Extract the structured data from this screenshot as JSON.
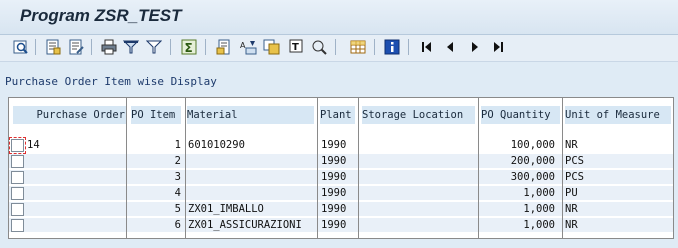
{
  "window": {
    "title": "Program ZSR_TEST"
  },
  "toolbar": {
    "icons": [
      "details-icon",
      "choose-layout-icon",
      "change-layout-icon",
      "print-icon",
      "filter-icon",
      "set-filter-icon",
      "sum-icon",
      "subtotal-icon",
      "sort-ascending-icon",
      "sort-descending-icon",
      "find-icon",
      "find-next-icon",
      "spreadsheet-icon",
      "info-icon",
      "first-page-icon",
      "previous-page-icon",
      "next-page-icon",
      "last-page-icon"
    ]
  },
  "report": {
    "subtitle": "Purchase Order Item wise Display"
  },
  "table": {
    "columns": [
      "Purchase Order",
      "PO Item",
      "Material",
      "Plant",
      "Storage Location",
      "PO Quantity",
      "Unit of Measure"
    ],
    "rows": [
      {
        "po": "14",
        "item": "1",
        "material": "601010290",
        "plant": "1990",
        "sloc": "",
        "qty": "100,000",
        "uom": "NR"
      },
      {
        "po": "",
        "item": "2",
        "material": "",
        "plant": "1990",
        "sloc": "",
        "qty": "200,000",
        "uom": "PCS"
      },
      {
        "po": "",
        "item": "3",
        "material": "",
        "plant": "1990",
        "sloc": "",
        "qty": "300,000",
        "uom": "PCS"
      },
      {
        "po": "",
        "item": "4",
        "material": "",
        "plant": "1990",
        "sloc": "",
        "qty": "1,000",
        "uom": "PU"
      },
      {
        "po": "",
        "item": "5",
        "material": "ZX01_IMBALLO",
        "plant": "1990",
        "sloc": "",
        "qty": "1,000",
        "uom": "NR"
      },
      {
        "po": "",
        "item": "6",
        "material": "ZX01_ASSICURAZIONI",
        "plant": "1990",
        "sloc": "",
        "qty": "1,000",
        "uom": "NR"
      }
    ]
  }
}
